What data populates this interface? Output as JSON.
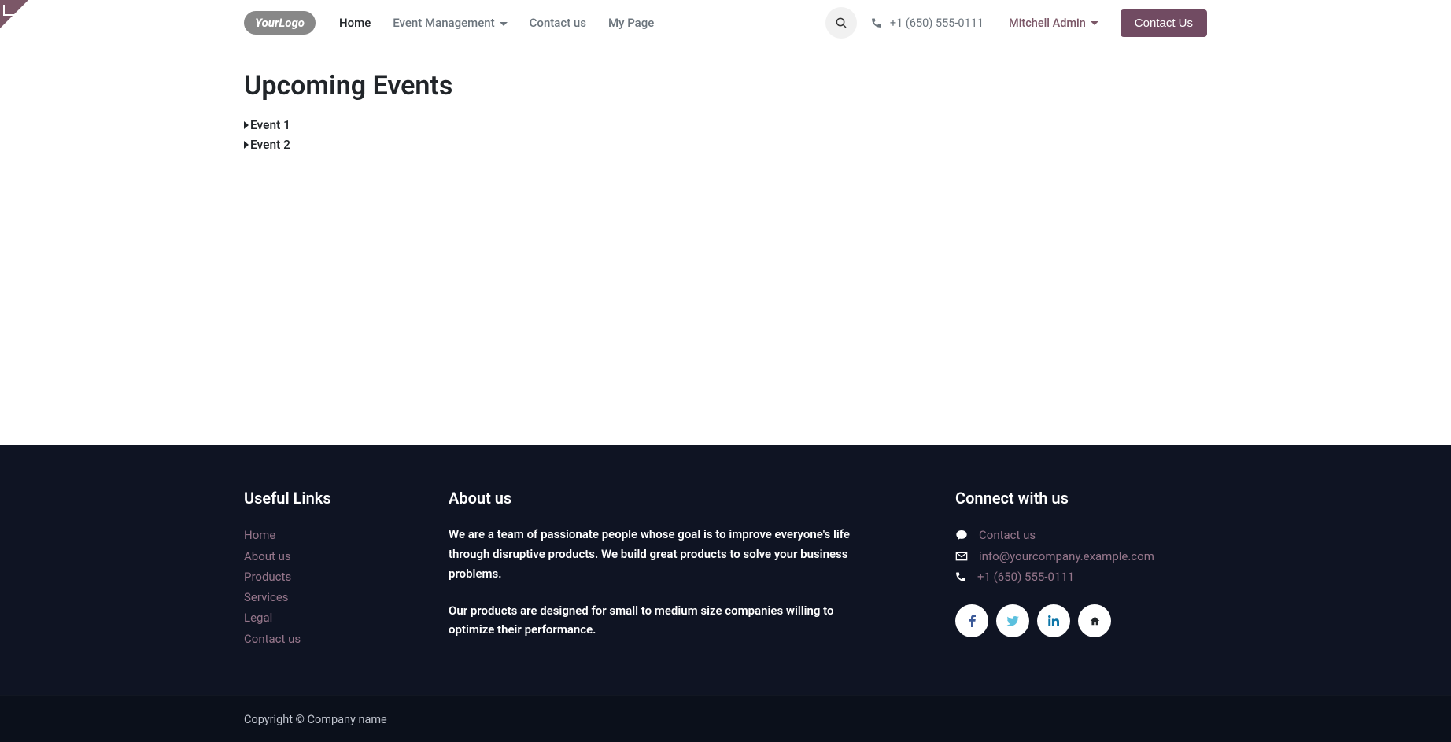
{
  "corner": {
    "label": ""
  },
  "header": {
    "logo_text": "YourLogo",
    "nav": [
      {
        "label": "Home",
        "active": true
      },
      {
        "label": "Event Management",
        "dropdown": true
      },
      {
        "label": "Contact us"
      },
      {
        "label": "My Page"
      }
    ],
    "phone": "+1 (650) 555-0111",
    "user": "Mitchell Admin",
    "contact_button": "Contact Us"
  },
  "main": {
    "title": "Upcoming Events",
    "events": [
      "Event 1",
      "Event 2"
    ]
  },
  "footer": {
    "useful_title": "Useful Links",
    "useful_links": [
      "Home",
      "About us",
      "Products",
      "Services",
      "Legal",
      "Contact us"
    ],
    "about_title": "About us",
    "about_p1": "We are a team of passionate people whose goal is to improve everyone's life through disruptive products. We build great products to solve your business problems.",
    "about_p2": "Our products are designed for small to medium size companies willing to optimize their performance.",
    "connect_title": "Connect with us",
    "connect_contact": "Contact us",
    "connect_email": "info@yourcompany.example.com",
    "connect_phone": "+1 (650) 555-0111",
    "copyright": "Copyright © Company name"
  }
}
